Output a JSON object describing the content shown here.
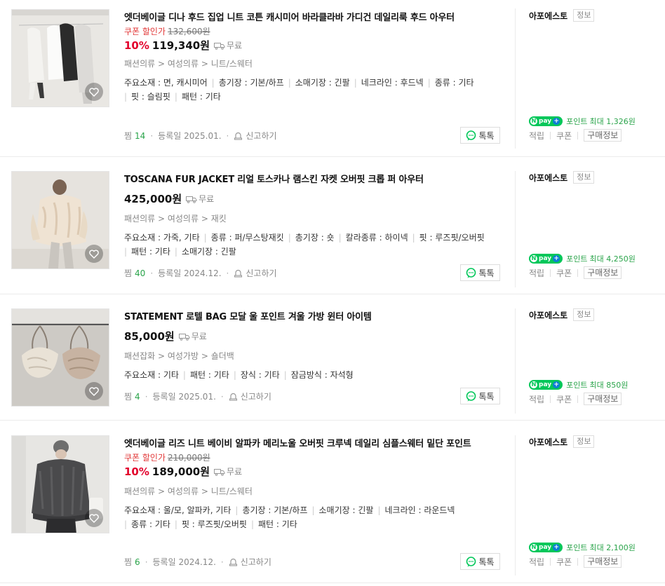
{
  "products": [
    {
      "title": "엣더베이글 디나 후드 집업 니트 코튼 캐시미어 바라클라바 가디건 데일리룩 후드 아우터",
      "coupon_label": "쿠폰 할인가",
      "original_price": "132,600원",
      "discount": "10%",
      "price": "119,340원",
      "shipping": "무료",
      "category": "패션의류 > 여성의류 > 니트/스웨터",
      "specs": [
        "주요소재 : 면, 캐시미어",
        "총기장 : 기본/하프",
        "소매기장 : 긴팔",
        "네크라인 : 후드넥",
        "종류 : 기타",
        "핏 : 슬림핏",
        "패턴 : 기타"
      ],
      "wish_label": "찜",
      "wish_count": "14",
      "reg_label": "등록일 2025.01.",
      "report_label": "신고하기",
      "talk_label": "톡톡",
      "seller": "아포에스토",
      "seller_tag": "정보",
      "npay": "pay",
      "points_label": "포인트",
      "points_max": "최대 1,326원",
      "link_accrue": "적립",
      "link_coupon": "쿠폰",
      "link_buyinfo": "구매정보"
    },
    {
      "title": "TOSCANA FUR JACKET 리얼 토스카나 램스킨 자켓 오버핏 크롭 퍼 아우터",
      "coupon_label": "",
      "original_price": "",
      "discount": "",
      "price": "425,000원",
      "shipping": "무료",
      "category": "패션의류 > 여성의류 > 재킷",
      "specs": [
        "주요소재 : 가죽, 기타",
        "종류 : 퍼/무스탕재킷",
        "총기장 : 숏",
        "칼라종류 : 하이넥",
        "핏 : 루즈핏/오버핏",
        "패턴 : 기타",
        "소매기장 : 긴팔"
      ],
      "wish_label": "찜",
      "wish_count": "40",
      "reg_label": "등록일 2024.12.",
      "report_label": "신고하기",
      "talk_label": "톡톡",
      "seller": "아포에스토",
      "seller_tag": "정보",
      "npay": "pay",
      "points_label": "포인트",
      "points_max": "최대 4,250원",
      "link_accrue": "적립",
      "link_coupon": "쿠폰",
      "link_buyinfo": "구매정보"
    },
    {
      "title": "STATEMENT 로텔 BAG 모달 울 포인트 겨울 가방 윈터 아이템",
      "coupon_label": "",
      "original_price": "",
      "discount": "",
      "price": "85,000원",
      "shipping": "무료",
      "category": "패션잡화 > 여성가방 > 숄더백",
      "specs": [
        "주요소재 : 기타",
        "패턴 : 기타",
        "장식 : 기타",
        "잠금방식 : 자석형"
      ],
      "wish_label": "찜",
      "wish_count": "4",
      "reg_label": "등록일 2025.01.",
      "report_label": "신고하기",
      "talk_label": "톡톡",
      "seller": "아포에스토",
      "seller_tag": "정보",
      "npay": "pay",
      "points_label": "포인트",
      "points_max": "최대 850원",
      "link_accrue": "적립",
      "link_coupon": "쿠폰",
      "link_buyinfo": "구매정보"
    },
    {
      "title": "엣더베이글 리즈 니트 베이비 알파카 메리노울 오버핏 크루넥 데일리 심플스웨터 밑단 포인트",
      "coupon_label": "쿠폰 할인가",
      "original_price": "210,000원",
      "discount": "10%",
      "price": "189,000원",
      "shipping": "무료",
      "category": "패션의류 > 여성의류 > 니트/스웨터",
      "specs": [
        "주요소재 : 울/모, 알파카, 기타",
        "총기장 : 기본/하프",
        "소매기장 : 긴팔",
        "네크라인 : 라운드넥",
        "종류 : 기타",
        "핏 : 루즈핏/오버핏",
        "패턴 : 기타"
      ],
      "wish_label": "찜",
      "wish_count": "6",
      "reg_label": "등록일 2024.12.",
      "report_label": "신고하기",
      "talk_label": "톡톡",
      "seller": "아포에스토",
      "seller_tag": "정보",
      "npay": "pay",
      "points_label": "포인트",
      "points_max": "최대 2,100원",
      "link_accrue": "적립",
      "link_coupon": "쿠폰",
      "link_buyinfo": "구매정보"
    }
  ]
}
